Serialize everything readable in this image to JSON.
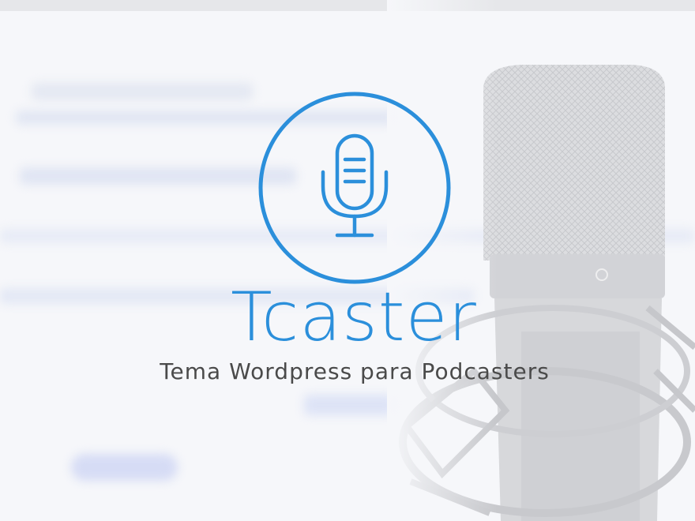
{
  "brand": {
    "title": "Tcaster",
    "tagline": "Tema Wordpress para Podcasters",
    "icon": "microphone-icon"
  },
  "colors": {
    "accent": "#2b8fdb",
    "tagline": "#4a4a4a",
    "background": "#f6f7fa",
    "mic_body": "#d7d8db",
    "mic_dark": "#c3c4c8"
  }
}
